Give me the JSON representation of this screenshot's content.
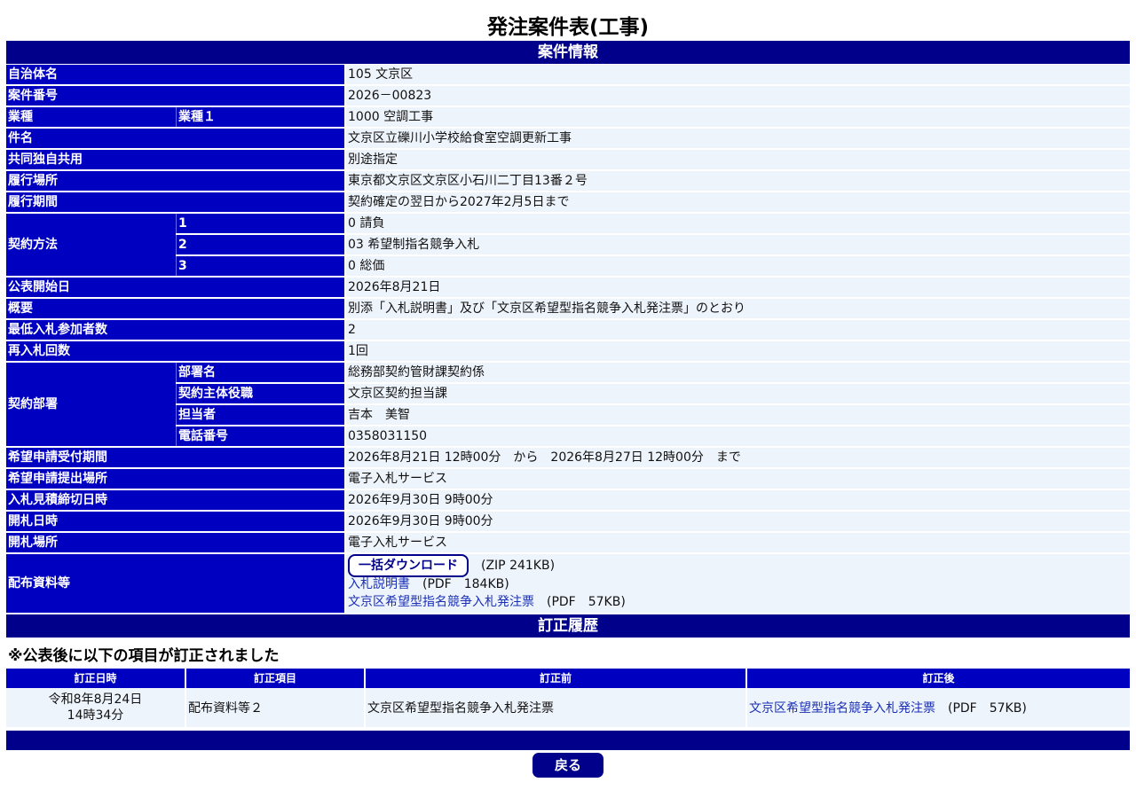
{
  "title": "発注案件表(工事)",
  "section_info": "案件情報",
  "rows": {
    "municipality": {
      "label": "自治体名",
      "value": "105 文京区"
    },
    "case_number": {
      "label": "案件番号",
      "value": "2026－00823"
    },
    "industry": {
      "label": "業種",
      "sub_label": "業種１",
      "value": "1000 空調工事"
    },
    "subject": {
      "label": "件名",
      "value": "文京区立礫川小学校給食室空調更新工事"
    },
    "joint": {
      "label": "共同独自共用",
      "value": "別途指定"
    },
    "place": {
      "label": "履行場所",
      "value": "東京都文京区文京区小石川二丁目13番２号"
    },
    "period": {
      "label": "履行期間",
      "value": "契約確定の翌日から2027年2月5日まで"
    },
    "contract_method": {
      "label": "契約方法",
      "items": [
        {
          "sub_label": "1",
          "value": "0 請負"
        },
        {
          "sub_label": "2",
          "value": "03 希望制指名競争入札"
        },
        {
          "sub_label": "3",
          "value": "0 総価"
        }
      ]
    },
    "publish_date": {
      "label": "公表開始日",
      "value": "2026年8月21日"
    },
    "overview": {
      "label": "概要",
      "value": "別添「入札説明書」及び「文京区希望型指名競争入札発注票」のとおり"
    },
    "min_bidders": {
      "label": "最低入札参加者数",
      "value": "2"
    },
    "rebid": {
      "label": "再入札回数",
      "value": "1回"
    },
    "contract_dept": {
      "label": "契約部署",
      "items": [
        {
          "sub_label": "部署名",
          "value": "総務部契約管財課契約係"
        },
        {
          "sub_label": "契約主体役職",
          "value": "文京区契約担当課"
        },
        {
          "sub_label": "担当者",
          "value": "吉本　美智"
        },
        {
          "sub_label": "電話番号",
          "value": "0358031150"
        }
      ]
    },
    "apply_period": {
      "label": "希望申請受付期間",
      "value": "2026年8月21日 12時00分　から　2026年8月27日 12時00分　まで"
    },
    "apply_place": {
      "label": "希望申請提出場所",
      "value": "電子入札サービス"
    },
    "bid_deadline": {
      "label": "入札見積締切日時",
      "value": "2026年9月30日 9時00分"
    },
    "opening_date": {
      "label": "開札日時",
      "value": "2026年9月30日 9時00分"
    },
    "opening_place": {
      "label": "開札場所",
      "value": "電子入札サービス"
    },
    "materials": {
      "label": "配布資料等",
      "download_label": "一括ダウンロード",
      "download_size": "(ZIP 241KB)",
      "files": [
        {
          "name": "入札説明書",
          "size": "(PDF　184KB)"
        },
        {
          "name": "文京区希望型指名競争入札発注票",
          "size": "(PDF　57KB)"
        }
      ]
    }
  },
  "section_history": "訂正履歴",
  "history_note": "※公表後に以下の項目が訂正されました",
  "history": {
    "headers": [
      "訂正日時",
      "訂正項目",
      "訂正前",
      "訂正後"
    ],
    "rows": [
      {
        "date_line1": "令和8年8月24日",
        "date_line2": "14時34分",
        "item": "配布資料等２",
        "before": "文京区希望型指名競争入札発注票",
        "after_link": "文京区希望型指名競争入札発注票",
        "after_size": "(PDF　57KB)"
      }
    ]
  },
  "back_label": "戻る"
}
